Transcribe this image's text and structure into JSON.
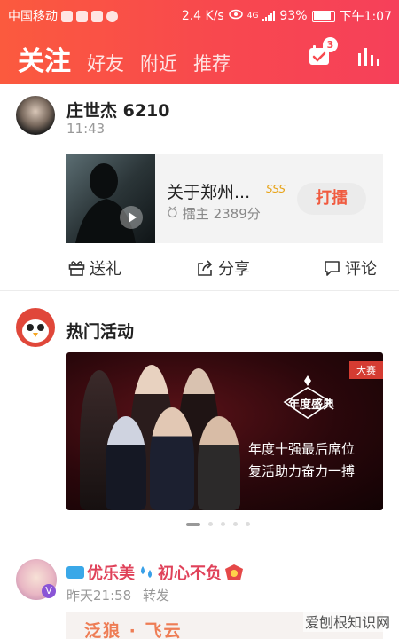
{
  "status_bar": {
    "carrier": "中国移动",
    "network_speed": "2.4 K/s",
    "network_type": "4G",
    "battery": "93%",
    "time": "下午1:07"
  },
  "header": {
    "active_tab": "关注",
    "tabs": [
      "好友",
      "附近",
      "推荐"
    ],
    "notification_count": "3"
  },
  "posts": [
    {
      "user_name": "庄世杰 6210",
      "time": "11:43",
      "song": {
        "title": "关于郑州...",
        "level": "SSS",
        "host_label": "擂主",
        "score": "2389分",
        "action": "打擂"
      },
      "actions": [
        "送礼",
        "分享",
        "评论"
      ]
    },
    {
      "user_name": "热门活动",
      "banner": {
        "tag": "大赛",
        "logo_text": "年度盛典",
        "line1": "年度十强最后席位",
        "line2": "复活助力奋力一搏"
      },
      "carousel": {
        "count": 5,
        "active": 0
      }
    },
    {
      "user_name": "优乐美",
      "user_name_suffix": "初心不负",
      "time": "昨天21:58",
      "action": "转发",
      "preview_text": "泛狼 · 飞云"
    }
  ],
  "watermark": "爱刨根知识网",
  "colors": {
    "header_start": "#fb5a3e",
    "header_end": "#f6405a",
    "accent": "#f05a3f"
  }
}
